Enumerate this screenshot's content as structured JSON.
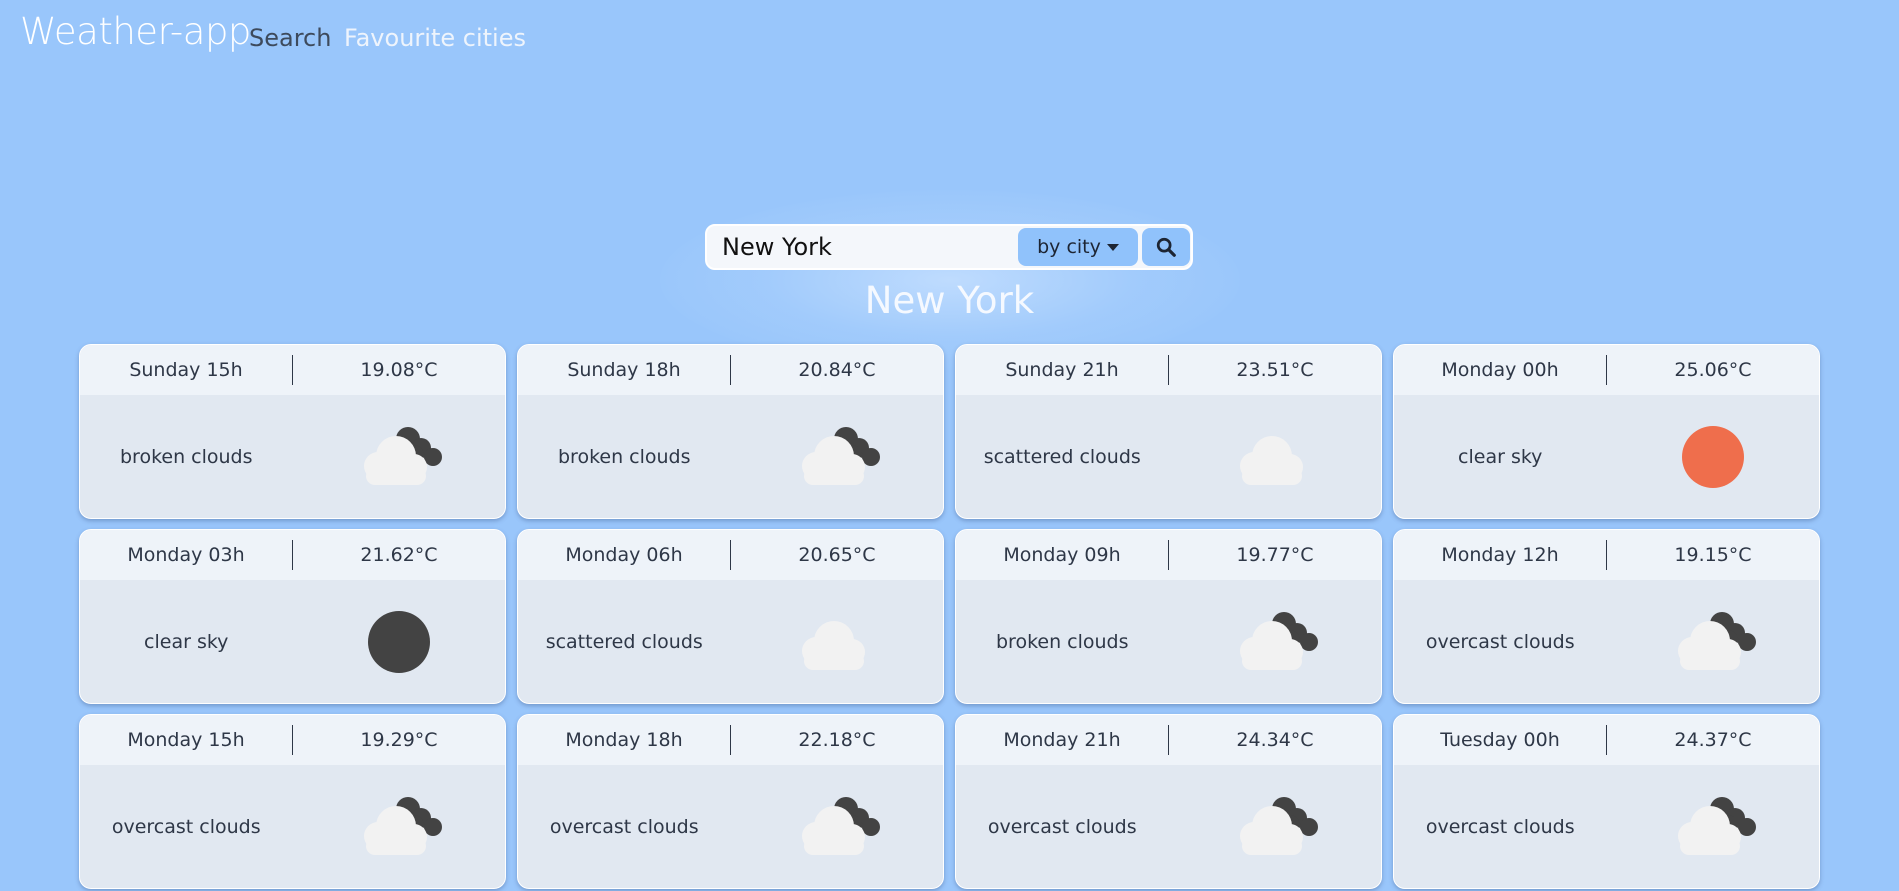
{
  "nav": {
    "brand": "Weather-app",
    "search_link": "Search",
    "favourites_link": "Favourite cities"
  },
  "search": {
    "value": "New York",
    "mode_label": "by city",
    "mode_icon": "caret-down-icon",
    "button_icon": "search-icon"
  },
  "city": "New York",
  "colors": {
    "background": "#99c6fb",
    "sun": "#ef6e4c",
    "moon": "#434343",
    "cloud": "#f2f2f2",
    "dark_cloud": "#434343"
  },
  "forecasts": [
    {
      "time": "Sunday 15h",
      "temp": "19.08°C",
      "description": "broken clouds",
      "icon": "cloud-dark-icon"
    },
    {
      "time": "Sunday 18h",
      "temp": "20.84°C",
      "description": "broken clouds",
      "icon": "cloud-dark-icon"
    },
    {
      "time": "Sunday 21h",
      "temp": "23.51°C",
      "description": "scattered clouds",
      "icon": "cloud-icon"
    },
    {
      "time": "Monday 00h",
      "temp": "25.06°C",
      "description": "clear sky",
      "icon": "sun-icon"
    },
    {
      "time": "Monday 03h",
      "temp": "21.62°C",
      "description": "clear sky",
      "icon": "moon-icon"
    },
    {
      "time": "Monday 06h",
      "temp": "20.65°C",
      "description": "scattered clouds",
      "icon": "cloud-icon"
    },
    {
      "time": "Monday 09h",
      "temp": "19.77°C",
      "description": "broken clouds",
      "icon": "cloud-dark-icon"
    },
    {
      "time": "Monday 12h",
      "temp": "19.15°C",
      "description": "overcast clouds",
      "icon": "cloud-dark-icon"
    },
    {
      "time": "Monday 15h",
      "temp": "19.29°C",
      "description": "overcast clouds",
      "icon": "cloud-dark-icon"
    },
    {
      "time": "Monday 18h",
      "temp": "22.18°C",
      "description": "overcast clouds",
      "icon": "cloud-dark-icon"
    },
    {
      "time": "Monday 21h",
      "temp": "24.34°C",
      "description": "overcast clouds",
      "icon": "cloud-dark-icon"
    },
    {
      "time": "Tuesday 00h",
      "temp": "24.37°C",
      "description": "overcast clouds",
      "icon": "cloud-dark-icon"
    }
  ]
}
